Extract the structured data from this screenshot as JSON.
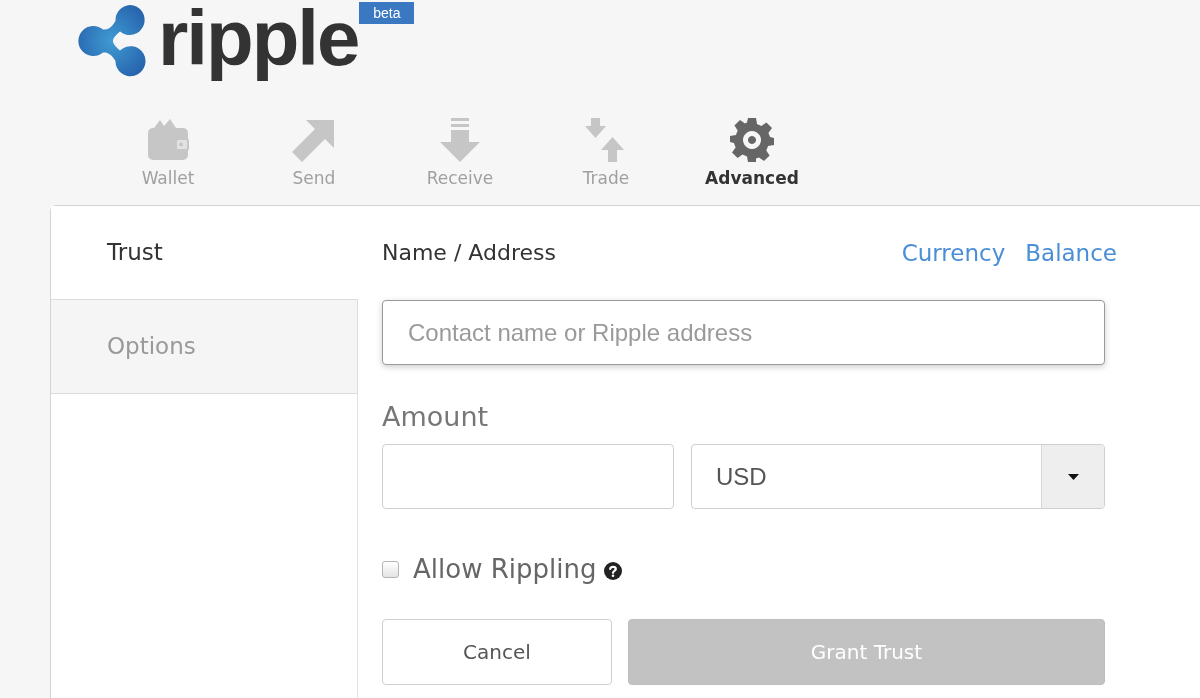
{
  "logo": {
    "wordmark": "ripple",
    "badge": "beta"
  },
  "nav": [
    {
      "label": "Wallet",
      "kind": "wallet",
      "selected": false
    },
    {
      "label": "Send",
      "kind": "send",
      "selected": false
    },
    {
      "label": "Receive",
      "kind": "receive",
      "selected": false
    },
    {
      "label": "Trade",
      "kind": "trade",
      "selected": false
    },
    {
      "label": "Advanced",
      "kind": "advanced",
      "selected": true
    }
  ],
  "sidebar": {
    "tabs": [
      {
        "label": "Trust",
        "selected": true
      },
      {
        "label": "Options",
        "selected": false
      }
    ]
  },
  "form": {
    "name_label": "Name / Address",
    "header_links": [
      "Currency",
      "Balance"
    ],
    "address_field": {
      "placeholder": "Contact name or Ripple address"
    },
    "amount_label": "Amount",
    "currency_select": {
      "value": "USD"
    },
    "allow_rippling": {
      "label": "Allow Rippling",
      "checked": false
    },
    "buttons": [
      {
        "label": "Cancel",
        "disabled": false
      },
      {
        "label": "Grant Trust",
        "disabled": true
      }
    ]
  }
}
